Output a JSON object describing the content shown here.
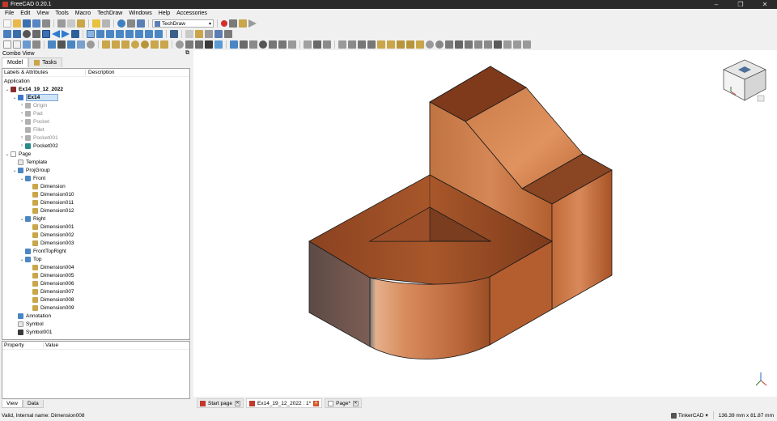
{
  "window": {
    "title": "FreeCAD 0.20.1",
    "controls": [
      "–",
      "❐",
      "✕"
    ]
  },
  "menu": [
    "File",
    "Edit",
    "View",
    "Tools",
    "Macro",
    "TechDraw",
    "Windows",
    "Help",
    "Accessories"
  ],
  "toolbar": {
    "workbench": "TechDraw"
  },
  "combo": {
    "title": "Combo View",
    "float_glyph": "⧉",
    "tabs": [
      {
        "label": "Model"
      },
      {
        "label": "Tasks"
      }
    ],
    "tree_headers": {
      "labels": "Labels & Attributes",
      "description": "Description"
    },
    "tree_group": "Application",
    "tree": [
      {
        "label": "Ex14_19_12_2022",
        "depth": 0,
        "arrow": "⌄",
        "icon": "document-icon",
        "color": "#8a2c2c",
        "style": "bold"
      },
      {
        "label": "Ex14",
        "depth": 1,
        "arrow": "⌄",
        "icon": "body-icon",
        "color": "#3c78c8",
        "style": "selected"
      },
      {
        "label": "Origin",
        "depth": 2,
        "arrow": "›",
        "icon": "origin-icon",
        "color": "#b0b0b0",
        "style": "grey"
      },
      {
        "label": "Pad",
        "depth": 2,
        "arrow": "›",
        "icon": "pad-icon",
        "color": "#b0b0b0",
        "style": "grey"
      },
      {
        "label": "Pocket",
        "depth": 2,
        "arrow": "›",
        "icon": "pocket-icon",
        "color": "#b0b0b0",
        "style": "grey"
      },
      {
        "label": "Fillet",
        "depth": 2,
        "arrow": "",
        "icon": "fillet-icon",
        "color": "#b0b0b0",
        "style": "grey"
      },
      {
        "label": "Pocket001",
        "depth": 2,
        "arrow": "›",
        "icon": "pocket-icon",
        "color": "#b0b0b0",
        "style": "grey"
      },
      {
        "label": "Pocket002",
        "depth": 2,
        "arrow": "›",
        "icon": "pocket-icon",
        "color": "#2a8a8a",
        "style": ""
      },
      {
        "label": "Page",
        "depth": 0,
        "arrow": "⌄",
        "icon": "page-icon",
        "color": "#ffffff",
        "style": ""
      },
      {
        "label": "Template",
        "depth": 1,
        "arrow": "",
        "icon": "template-icon",
        "color": "#e8e8e8",
        "style": ""
      },
      {
        "label": "ProjGroup",
        "depth": 1,
        "arrow": "⌄",
        "icon": "projgroup-icon",
        "color": "#4b86c4",
        "style": ""
      },
      {
        "label": "Front",
        "depth": 2,
        "arrow": "⌄",
        "icon": "view-icon",
        "color": "#4b86c4",
        "style": ""
      },
      {
        "label": "Dimension",
        "depth": 3,
        "arrow": "",
        "icon": "dimension-icon",
        "color": "#c9a64a",
        "style": ""
      },
      {
        "label": "Dimension010",
        "depth": 3,
        "arrow": "",
        "icon": "dimension-icon",
        "color": "#c9a64a",
        "style": ""
      },
      {
        "label": "Dimension011",
        "depth": 3,
        "arrow": "",
        "icon": "dimension-icon",
        "color": "#c9a64a",
        "style": ""
      },
      {
        "label": "Dimension012",
        "depth": 3,
        "arrow": "",
        "icon": "dimension-icon",
        "color": "#c9a64a",
        "style": ""
      },
      {
        "label": "Right",
        "depth": 2,
        "arrow": "⌄",
        "icon": "view-icon",
        "color": "#4b86c4",
        "style": ""
      },
      {
        "label": "Dimension001",
        "depth": 3,
        "arrow": "",
        "icon": "dimension-icon",
        "color": "#c9a64a",
        "style": ""
      },
      {
        "label": "Dimension002",
        "depth": 3,
        "arrow": "",
        "icon": "dimension-icon",
        "color": "#c9a64a",
        "style": ""
      },
      {
        "label": "Dimension003",
        "depth": 3,
        "arrow": "",
        "icon": "dimension-icon",
        "color": "#c9a64a",
        "style": ""
      },
      {
        "label": "FrontTopRight",
        "depth": 2,
        "arrow": "",
        "icon": "view-icon",
        "color": "#4b86c4",
        "style": ""
      },
      {
        "label": "Top",
        "depth": 2,
        "arrow": "⌄",
        "icon": "view-icon",
        "color": "#4b86c4",
        "style": ""
      },
      {
        "label": "Dimension004",
        "depth": 3,
        "arrow": "",
        "icon": "dimension-icon",
        "color": "#c9a64a",
        "style": ""
      },
      {
        "label": "Dimension005",
        "depth": 3,
        "arrow": "",
        "icon": "dimension-icon",
        "color": "#c9a64a",
        "style": ""
      },
      {
        "label": "Dimension006",
        "depth": 3,
        "arrow": "",
        "icon": "dimension-icon",
        "color": "#c9a64a",
        "style": ""
      },
      {
        "label": "Dimension007",
        "depth": 3,
        "arrow": "",
        "icon": "dimension-icon",
        "color": "#c9a64a",
        "style": ""
      },
      {
        "label": "Dimension008",
        "depth": 3,
        "arrow": "",
        "icon": "dimension-icon",
        "color": "#c9a64a",
        "style": ""
      },
      {
        "label": "Dimension009",
        "depth": 3,
        "arrow": "",
        "icon": "dimension-icon",
        "color": "#c9a64a",
        "style": ""
      },
      {
        "label": "Annotation",
        "depth": 1,
        "arrow": "",
        "icon": "annotation-icon",
        "color": "#4b86c4",
        "style": ""
      },
      {
        "label": "Symbol",
        "depth": 1,
        "arrow": "",
        "icon": "symbol-icon",
        "color": "#e8e8e8",
        "style": ""
      },
      {
        "label": "Symbol001",
        "depth": 1,
        "arrow": "",
        "icon": "symbol-icon",
        "color": "#3a3a3a",
        "style": ""
      }
    ],
    "property_headers": {
      "property": "Property",
      "value": "Value"
    },
    "bottom_tabs": [
      "View",
      "Data"
    ]
  },
  "doc_tabs": [
    {
      "label": "Start page",
      "icon": "start-page-icon",
      "active": false
    },
    {
      "label": "Ex14_19_12_2022 : 1*",
      "icon": "freecad-doc-icon",
      "active": true
    },
    {
      "label": "Page*",
      "icon": "page-icon",
      "active": false
    }
  ],
  "status": {
    "message": "Valid, Internal name: Dimension008",
    "navigation_style": "TinkerCAD",
    "dimensions": "136.39 mm x 81.87 mm"
  },
  "colors": {
    "titlebar": "#2b2b2b",
    "selection": "#cfe3f7",
    "model_copper": "#b8652f",
    "record_button": "#d32f2f"
  }
}
